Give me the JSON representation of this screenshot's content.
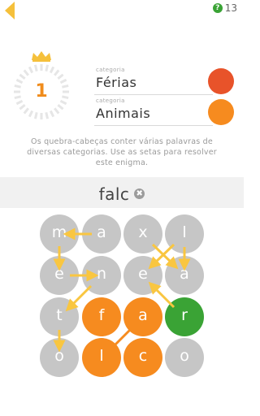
{
  "header": {
    "hint_count": "13",
    "hint_icon_glyph": "?"
  },
  "level": {
    "number": "1"
  },
  "categories": [
    {
      "label": "categoria",
      "name": "Férias",
      "color": "#e8532a"
    },
    {
      "label": "categoria",
      "name": "Animais",
      "color": "#f68b1f"
    }
  ],
  "instructions": "Os quebra-cabeças conter várias palavras de diversas categorias. Use as setas para resolver este enigma.",
  "current_word": "falc",
  "clear_glyph": "✖",
  "grid": {
    "rows": [
      [
        {
          "letter": "m",
          "state": "gray"
        },
        {
          "letter": "a",
          "state": "gray"
        },
        {
          "letter": "x",
          "state": "gray"
        },
        {
          "letter": "l",
          "state": "gray"
        }
      ],
      [
        {
          "letter": "e",
          "state": "gray"
        },
        {
          "letter": "n",
          "state": "gray"
        },
        {
          "letter": "e",
          "state": "gray"
        },
        {
          "letter": "a",
          "state": "gray"
        }
      ],
      [
        {
          "letter": "t",
          "state": "gray"
        },
        {
          "letter": "f",
          "state": "orange"
        },
        {
          "letter": "a",
          "state": "orange"
        },
        {
          "letter": "r",
          "state": "green"
        }
      ],
      [
        {
          "letter": "o",
          "state": "gray"
        },
        {
          "letter": "l",
          "state": "orange"
        },
        {
          "letter": "c",
          "state": "orange"
        },
        {
          "letter": "o",
          "state": "gray"
        }
      ]
    ]
  },
  "colors": {
    "gray": "#c6c6c6",
    "orange": "#f68b1f",
    "green": "#3aa335",
    "arrow": "#f9c640",
    "back_arrow": "#f5c03b",
    "crown": "#f5c03b"
  }
}
